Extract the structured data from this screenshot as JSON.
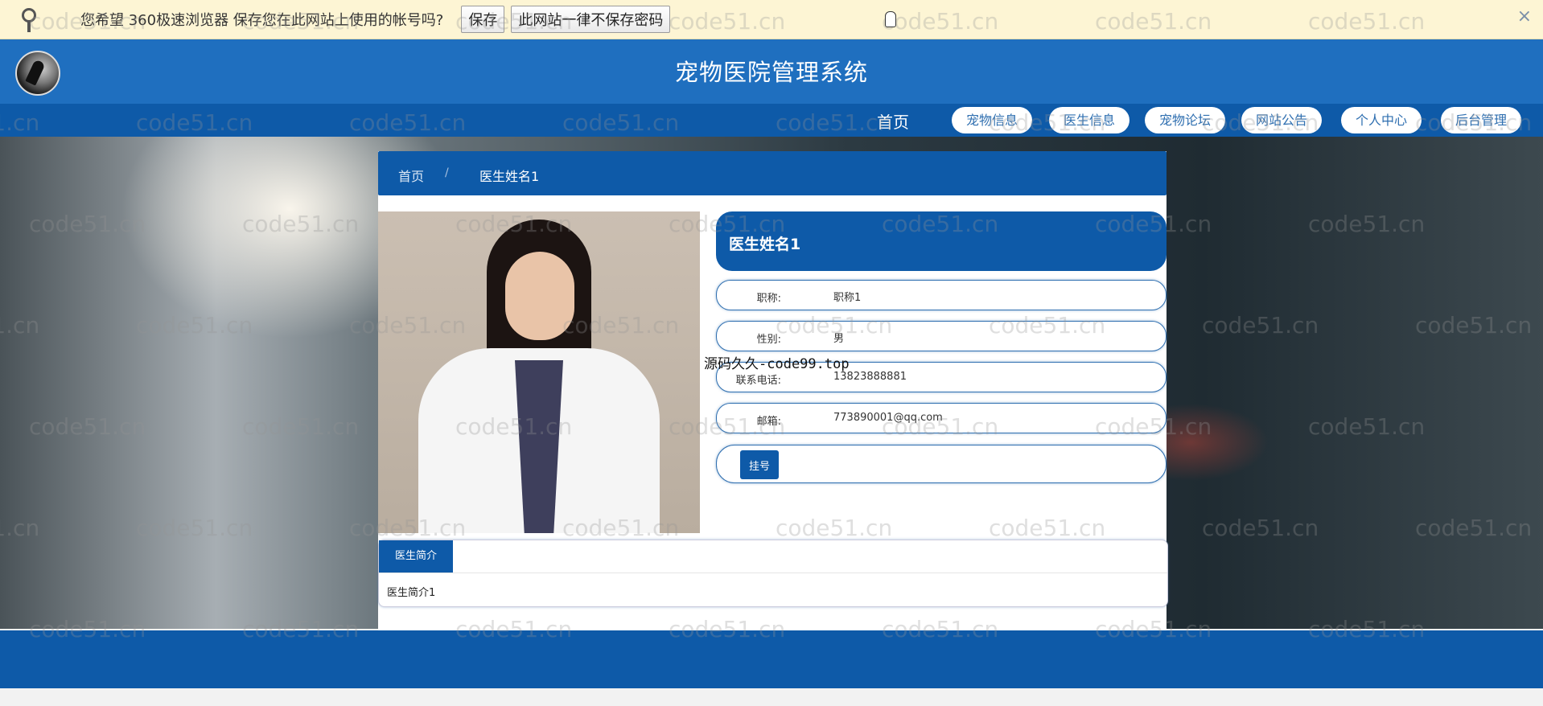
{
  "password_bar": {
    "message": "您希望 360极速浏览器 保存您在此网站上使用的帐号吗?",
    "save_label": "保存",
    "never_label": "此网站一律不保存密码",
    "close_glyph": "×"
  },
  "header": {
    "title": "宠物医院管理系统"
  },
  "nav": {
    "home": "首页",
    "items": [
      "宠物信息",
      "医生信息",
      "宠物论坛",
      "网站公告",
      "个人中心",
      "后台管理"
    ]
  },
  "breadcrumb": {
    "home": "首页",
    "separator": "/",
    "current": "医生姓名1"
  },
  "doctor": {
    "name": "医生姓名1",
    "fields": [
      {
        "label": "职称:",
        "value": "职称1"
      },
      {
        "label": "性别:",
        "value": "男"
      },
      {
        "label": "联系电话:",
        "value": "13823888881"
      },
      {
        "label": "邮箱:",
        "value": "773890001@qq.com"
      }
    ],
    "book_label": "挂号"
  },
  "intro": {
    "tab": "医生简介",
    "text": "医生简介1"
  },
  "overlay": "源码久久-code99.top",
  "watermark": "code51.cn",
  "colors": {
    "primary": "#0e5aa8",
    "header": "#1f6fbf",
    "bar": "#fdf5d4"
  }
}
